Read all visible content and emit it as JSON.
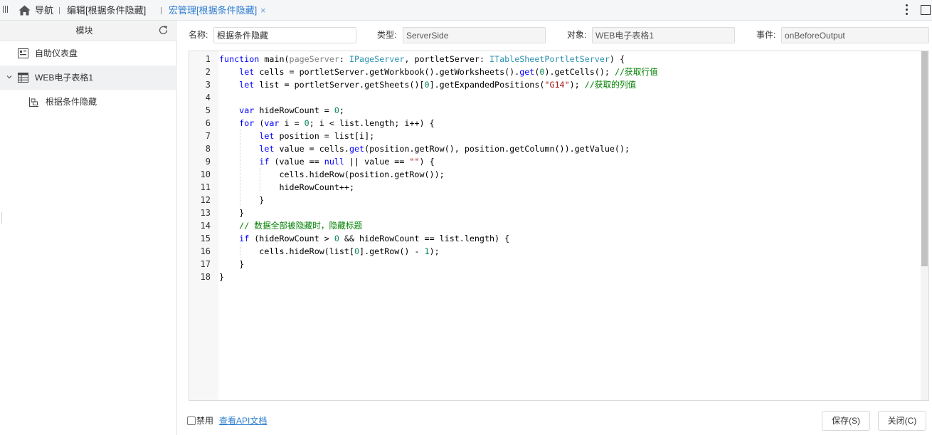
{
  "tabs": {
    "nav_label": "导航",
    "edit_label": "编辑[根据条件隐藏]",
    "macro_label": "宏管理[根据条件隐藏]",
    "close_glyph": "×"
  },
  "sidebar": {
    "title": "模块",
    "items": [
      {
        "label": "自助仪表盘",
        "icon": "dashboard-icon"
      },
      {
        "label": "WEB电子表格1",
        "icon": "spreadsheet-icon",
        "expanded": true
      },
      {
        "label": "根据条件隐藏",
        "icon": "macro-icon"
      }
    ]
  },
  "form": {
    "name_label": "名称:",
    "name_value": "根据条件隐藏",
    "type_label": "类型:",
    "type_value": "ServerSide",
    "object_label": "对象:",
    "object_value": "WEB电子表格1",
    "event_label": "事件:",
    "event_value": "onBeforeOutput"
  },
  "editor": {
    "colors": {
      "keyword": "#0000ff",
      "type": "#2b91af",
      "comment": "#008000",
      "string": "#a31515",
      "number": "#098658",
      "param": "#808080"
    },
    "line_numbers": [
      "1",
      "2",
      "3",
      "4",
      "5",
      "6",
      "7",
      "8",
      "9",
      "10",
      "11",
      "12",
      "13",
      "14",
      "15",
      "16",
      "17",
      "18"
    ],
    "code": [
      "function main(pageServer: IPageServer, portletServer: ITableSheetPortletServer) {",
      "    let cells = portletServer.getWorkbook().getWorksheets().get(0).getCells(); //获取行值",
      "    let list = portletServer.getSheets()[0].getExpandedPositions(\"G14\"); //获取的列值",
      "",
      "    var hideRowCount = 0;",
      "    for (var i = 0; i < list.length; i++) {",
      "        let position = list[i];",
      "        let value = cells.get(position.getRow(), position.getColumn()).getValue();",
      "        if (value == null || value == \"\") {",
      "            cells.hideRow(position.getRow());",
      "            hideRowCount++;",
      "        }",
      "    }",
      "    // 数据全部被隐藏时，隐藏标题",
      "    if (hideRowCount > 0 && hideRowCount == list.length) {",
      "        cells.hideRow(list[0].getRow() - 1);",
      "    }",
      "}"
    ]
  },
  "footer": {
    "disable_label": "禁用",
    "api_link": "查看API文档",
    "save_label": "保存(S)",
    "close_label": "关闭(C)"
  }
}
